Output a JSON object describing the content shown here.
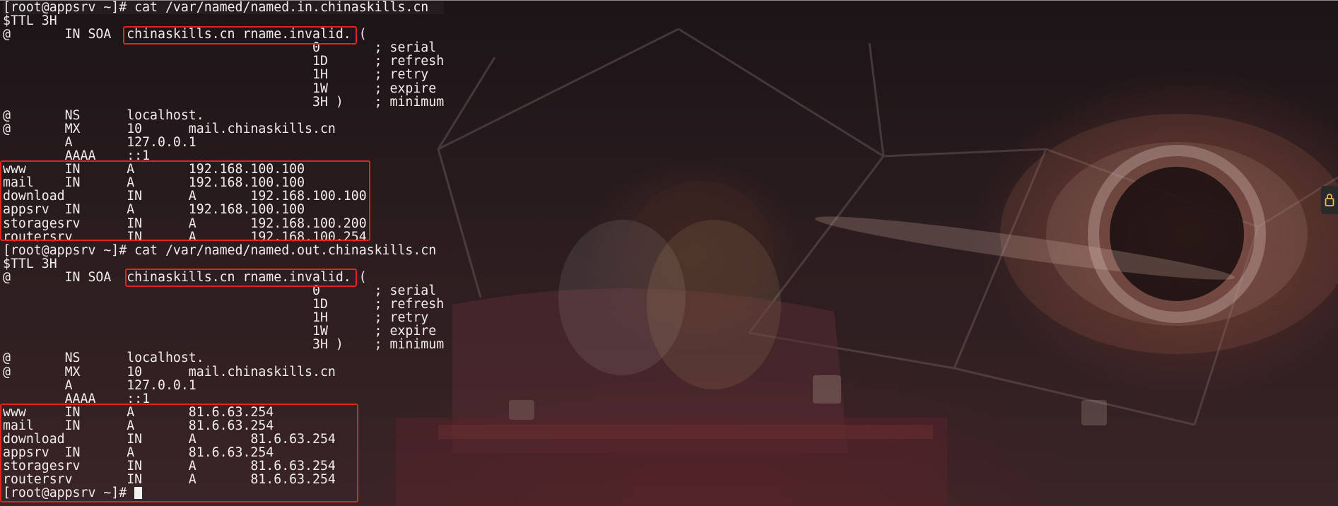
{
  "terminal": {
    "lines": [
      "[root@appsrv ~]# cat /var/named/named.in.chinaskills.cn",
      "$TTL 3H",
      "@       IN SOA  chinaskills.cn rname.invalid. (",
      "                                        0       ; serial",
      "                                        1D      ; refresh",
      "                                        1H      ; retry",
      "                                        1W      ; expire",
      "                                        3H )    ; minimum",
      "@       NS      localhost.",
      "@       MX      10      mail.chinaskills.cn",
      "        A       127.0.0.1",
      "        AAAA    ::1",
      "www     IN      A       192.168.100.100",
      "mail    IN      A       192.168.100.100",
      "download        IN      A       192.168.100.100",
      "appsrv  IN      A       192.168.100.100",
      "storagesrv      IN      A       192.168.100.200",
      "routersrv       IN      A       192.168.100.254",
      "[root@appsrv ~]# cat /var/named/named.out.chinaskills.cn",
      "$TTL 3H",
      "@       IN SOA  chinaskills.cn rname.invalid. (",
      "                                        0       ; serial",
      "                                        1D      ; refresh",
      "                                        1H      ; retry",
      "                                        1W      ; expire",
      "                                        3H )    ; minimum",
      "@       NS      localhost.",
      "@       MX      10      mail.chinaskills.cn",
      "        A       127.0.0.1",
      "        AAAA    ::1",
      "www     IN      A       81.6.63.254",
      "mail    IN      A       81.6.63.254",
      "download        IN      A       81.6.63.254",
      "appsrv  IN      A       81.6.63.254",
      "storagesrv      IN      A       81.6.63.254",
      "routersrv       IN      A       81.6.63.254"
    ],
    "final_prompt": "[root@appsrv ~]# "
  },
  "colors": {
    "terminal_text": "#f2ecec",
    "highlight_box": "#e02420"
  },
  "icons": {
    "side_tab": "lock-icon"
  }
}
